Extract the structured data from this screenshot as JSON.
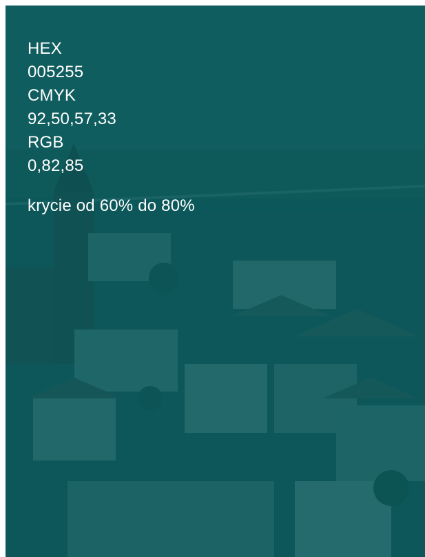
{
  "swatch": {
    "hex_label": "HEX",
    "hex_value": "005255",
    "cmyk_label": "CMYK",
    "cmyk_value": "92,50,57,33",
    "rgb_label": "RGB",
    "rgb_value": "0,82,85",
    "opacity_note": "krycie od 60% do 80%",
    "overlay_color": "#005255"
  }
}
